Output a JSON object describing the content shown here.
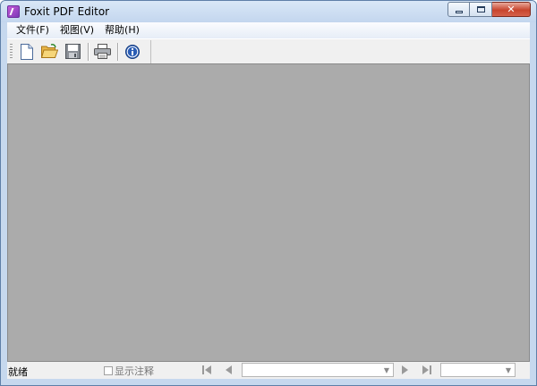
{
  "window": {
    "title": "Foxit PDF Editor"
  },
  "menu": [
    {
      "label": "文件(F)"
    },
    {
      "label": "视图(V)"
    },
    {
      "label": "帮助(H)"
    }
  ],
  "toolbar": {
    "icons": [
      "new-document-icon",
      "open-folder-icon",
      "save-icon",
      "print-icon",
      "info-icon"
    ]
  },
  "status": {
    "ready_text": "就绪",
    "show_annotations_label": "显示注释",
    "show_annotations_checked": false,
    "page_value": "",
    "zoom_value": ""
  }
}
